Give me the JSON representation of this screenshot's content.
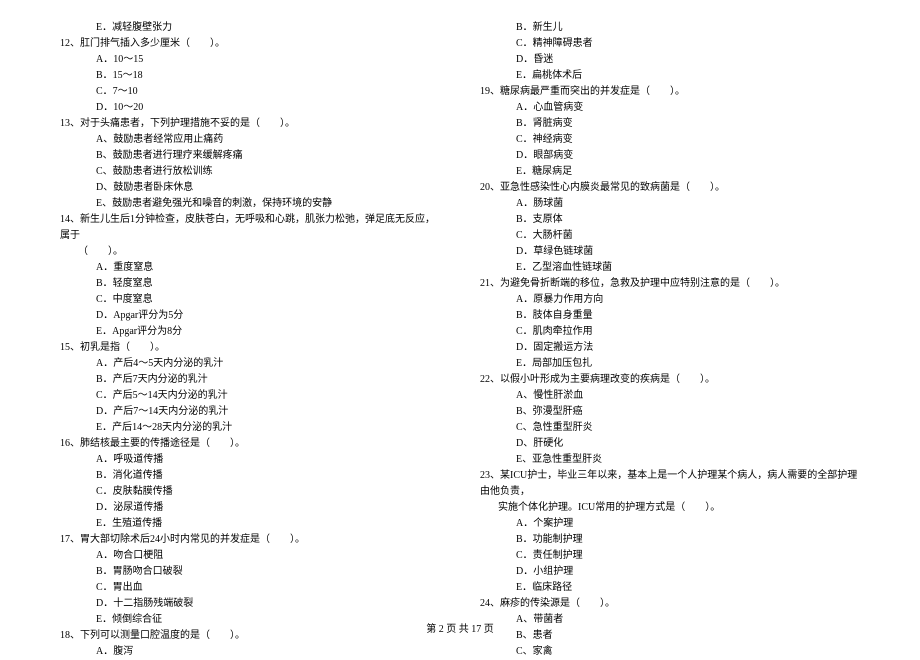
{
  "left_column": [
    {
      "type": "option",
      "text": "E．减轻腹壁张力"
    },
    {
      "type": "question",
      "text": "12、肛门排气插入多少厘米（　　）。"
    },
    {
      "type": "option",
      "text": "A．10～15"
    },
    {
      "type": "option",
      "text": "B．15～18"
    },
    {
      "type": "option",
      "text": "C．7～10"
    },
    {
      "type": "option",
      "text": "D．10～20"
    },
    {
      "type": "question",
      "text": "13、对于头痛患者，下列护理措施不妥的是（　　）。"
    },
    {
      "type": "option",
      "text": "A、鼓励患者经常应用止痛药"
    },
    {
      "type": "option",
      "text": "B、鼓励患者进行理疗来缓解疼痛"
    },
    {
      "type": "option",
      "text": "C、鼓励患者进行放松训练"
    },
    {
      "type": "option",
      "text": "D、鼓励患者卧床休息"
    },
    {
      "type": "option",
      "text": "E、鼓励患者避免强光和噪音的刺激，保持环境的安静"
    },
    {
      "type": "question",
      "text": "14、新生儿生后1分钟检查，皮肤苍白，无呼吸和心跳，肌张力松弛，弹足底无反应，属于"
    },
    {
      "type": "sub",
      "text": "（　　）。"
    },
    {
      "type": "option",
      "text": "A．重度窒息"
    },
    {
      "type": "option",
      "text": "B．轻度窒息"
    },
    {
      "type": "option",
      "text": "C．中度窒息"
    },
    {
      "type": "option",
      "text": "D．Apgar评分为5分"
    },
    {
      "type": "option",
      "text": "E．Apgar评分为8分"
    },
    {
      "type": "question",
      "text": "15、初乳是指（　　）。"
    },
    {
      "type": "option",
      "text": "A．产后4～5天内分泌的乳汁"
    },
    {
      "type": "option",
      "text": "B．产后7天内分泌的乳汁"
    },
    {
      "type": "option",
      "text": "C．产后5～14天内分泌的乳汁"
    },
    {
      "type": "option",
      "text": "D．产后7～14天内分泌的乳汁"
    },
    {
      "type": "option",
      "text": "E．产后14～28天内分泌的乳汁"
    },
    {
      "type": "question",
      "text": "16、肺结核最主要的传播途径是（　　）。"
    },
    {
      "type": "option",
      "text": "A．呼吸道传播"
    },
    {
      "type": "option",
      "text": "B．消化道传播"
    },
    {
      "type": "option",
      "text": "C．皮肤黏膜传播"
    },
    {
      "type": "option",
      "text": "D．泌尿道传播"
    },
    {
      "type": "option",
      "text": "E．生殖道传播"
    },
    {
      "type": "question",
      "text": "17、胃大部切除术后24小时内常见的并发症是（　　）。"
    },
    {
      "type": "option",
      "text": "A．吻合口梗阻"
    },
    {
      "type": "option",
      "text": "B．胃肠吻合口破裂"
    },
    {
      "type": "option",
      "text": "C．胃出血"
    },
    {
      "type": "option",
      "text": "D．十二指肠残端破裂"
    },
    {
      "type": "option",
      "text": "E．倾倒综合征"
    },
    {
      "type": "question",
      "text": "18、下列可以测量口腔温度的是（　　）。"
    },
    {
      "type": "option",
      "text": "A．腹泻"
    }
  ],
  "right_column": [
    {
      "type": "option",
      "text": "B．新生儿"
    },
    {
      "type": "option",
      "text": "C．精神障碍患者"
    },
    {
      "type": "option",
      "text": "D．昏迷"
    },
    {
      "type": "option",
      "text": "E．扁桃体术后"
    },
    {
      "type": "question",
      "text": "19、糖尿病最严重而突出的并发症是（　　）。"
    },
    {
      "type": "option",
      "text": "A．心血管病变"
    },
    {
      "type": "option",
      "text": "B．肾脏病变"
    },
    {
      "type": "option",
      "text": "C．神经病变"
    },
    {
      "type": "option",
      "text": "D．眼部病变"
    },
    {
      "type": "option",
      "text": "E．糖尿病足"
    },
    {
      "type": "question",
      "text": "20、亚急性感染性心内膜炎最常见的致病菌是（　　）。"
    },
    {
      "type": "option",
      "text": "A．肠球菌"
    },
    {
      "type": "option",
      "text": "B．支原体"
    },
    {
      "type": "option",
      "text": "C．大肠杆菌"
    },
    {
      "type": "option",
      "text": "D．草绿色链球菌"
    },
    {
      "type": "option",
      "text": "E．乙型溶血性链球菌"
    },
    {
      "type": "question",
      "text": "21、为避免骨折断端的移位，急救及护理中应特别注意的是（　　）。"
    },
    {
      "type": "option",
      "text": "A．原暴力作用方向"
    },
    {
      "type": "option",
      "text": "B．肢体自身重量"
    },
    {
      "type": "option",
      "text": "C．肌肉牵拉作用"
    },
    {
      "type": "option",
      "text": "D．固定搬运方法"
    },
    {
      "type": "option",
      "text": "E．局部加压包扎"
    },
    {
      "type": "question",
      "text": "22、以假小叶形成为主要病理改变的疾病是（　　）。"
    },
    {
      "type": "option",
      "text": "A、慢性肝淤血"
    },
    {
      "type": "option",
      "text": "B、弥漫型肝癌"
    },
    {
      "type": "option",
      "text": "C、急性重型肝炎"
    },
    {
      "type": "option",
      "text": "D、肝硬化"
    },
    {
      "type": "option",
      "text": "E、亚急性重型肝炎"
    },
    {
      "type": "question",
      "text": "23、某ICU护士，毕业三年以来，基本上是一个人护理某个病人，病人需要的全部护理由他负责，"
    },
    {
      "type": "sub",
      "text": "实施个体化护理。ICU常用的护理方式是（　　）。"
    },
    {
      "type": "option",
      "text": "A．个案护理"
    },
    {
      "type": "option",
      "text": "B．功能制护理"
    },
    {
      "type": "option",
      "text": "C．责任制护理"
    },
    {
      "type": "option",
      "text": "D．小组护理"
    },
    {
      "type": "option",
      "text": "E．临床路径"
    },
    {
      "type": "question",
      "text": "24、麻疹的传染源是（　　）。"
    },
    {
      "type": "option",
      "text": "A、带菌者"
    },
    {
      "type": "option",
      "text": "B、患者"
    },
    {
      "type": "option",
      "text": "C、家禽"
    }
  ],
  "footer": "第 2 页 共 17 页"
}
